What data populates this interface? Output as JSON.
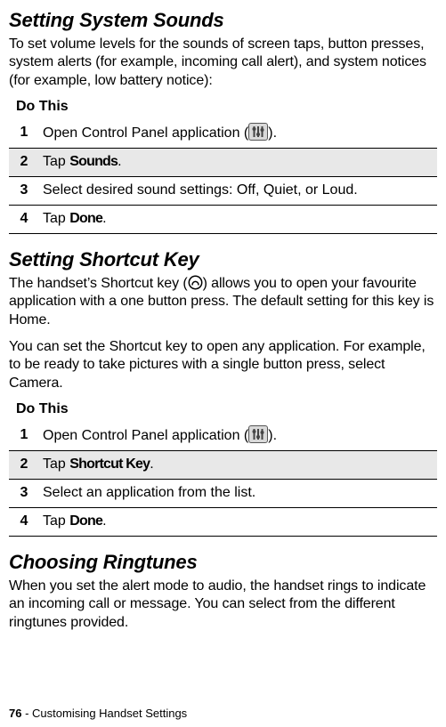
{
  "sections": {
    "sounds": {
      "heading": "Setting System Sounds",
      "intro": "To set volume levels for the sounds of screen taps, button presses, system alerts (for example, incoming call alert), and system notices (for example, low battery notice):",
      "doThis": "Do This",
      "steps": {
        "s1": {
          "num": "1",
          "text_a": "Open Control Panel application (",
          "text_b": ")."
        },
        "s2": {
          "num": "2",
          "text_a": "Tap ",
          "bold": "Sounds",
          "text_b": "."
        },
        "s3": {
          "num": "3",
          "text": "Select desired sound settings: Off, Quiet, or Loud."
        },
        "s4": {
          "num": "4",
          "text_a": "Tap ",
          "bold": "Done",
          "text_b": "."
        }
      }
    },
    "shortcut": {
      "heading": "Setting Shortcut Key",
      "intro1_a": "The handset’s Shortcut key (",
      "intro1_b": ") allows you to open your favourite application with a one button press. The default setting for this key is Home.",
      "intro2": "You can set the Shortcut key to open any application. For example, to be ready to take pictures with a single button press, select Camera.",
      "doThis": "Do This",
      "steps": {
        "s1": {
          "num": "1",
          "text_a": "Open Control Panel application (",
          "text_b": ")."
        },
        "s2": {
          "num": "2",
          "text_a": "Tap ",
          "bold": "Shortcut Key",
          "text_b": "."
        },
        "s3": {
          "num": "3",
          "text": "Select an application from the list."
        },
        "s4": {
          "num": "4",
          "text_a": "Tap ",
          "bold": "Done",
          "text_b": "."
        }
      }
    },
    "ringtunes": {
      "heading": "Choosing Ringtunes",
      "intro": "When you set the alert mode to audio, the handset rings to indicate an incoming call or message. You can select from the different ringtunes provided."
    }
  },
  "footer": {
    "page": "76",
    "sep": " - ",
    "chapter": "Customising Handset Settings"
  },
  "icons": {
    "control_panel": "control-panel-icon",
    "shortcut": "shortcut-key-icon"
  }
}
